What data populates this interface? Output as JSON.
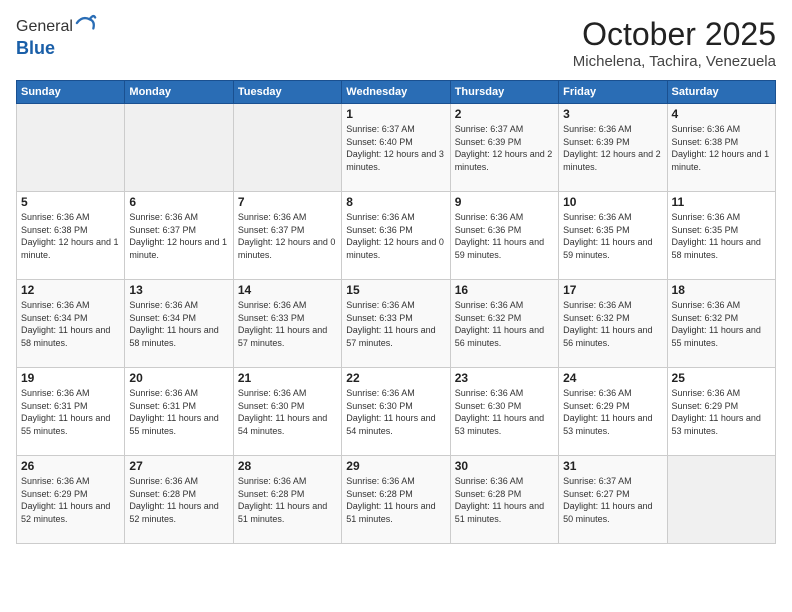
{
  "header": {
    "logo_line1": "General",
    "logo_line2": "Blue",
    "month": "October 2025",
    "location": "Michelena, Tachira, Venezuela"
  },
  "weekdays": [
    "Sunday",
    "Monday",
    "Tuesday",
    "Wednesday",
    "Thursday",
    "Friday",
    "Saturday"
  ],
  "weeks": [
    [
      {
        "day": "",
        "info": ""
      },
      {
        "day": "",
        "info": ""
      },
      {
        "day": "",
        "info": ""
      },
      {
        "day": "1",
        "info": "Sunrise: 6:37 AM\nSunset: 6:40 PM\nDaylight: 12 hours and 3 minutes."
      },
      {
        "day": "2",
        "info": "Sunrise: 6:37 AM\nSunset: 6:39 PM\nDaylight: 12 hours and 2 minutes."
      },
      {
        "day": "3",
        "info": "Sunrise: 6:36 AM\nSunset: 6:39 PM\nDaylight: 12 hours and 2 minutes."
      },
      {
        "day": "4",
        "info": "Sunrise: 6:36 AM\nSunset: 6:38 PM\nDaylight: 12 hours and 1 minute."
      }
    ],
    [
      {
        "day": "5",
        "info": "Sunrise: 6:36 AM\nSunset: 6:38 PM\nDaylight: 12 hours and 1 minute."
      },
      {
        "day": "6",
        "info": "Sunrise: 6:36 AM\nSunset: 6:37 PM\nDaylight: 12 hours and 1 minute."
      },
      {
        "day": "7",
        "info": "Sunrise: 6:36 AM\nSunset: 6:37 PM\nDaylight: 12 hours and 0 minutes."
      },
      {
        "day": "8",
        "info": "Sunrise: 6:36 AM\nSunset: 6:36 PM\nDaylight: 12 hours and 0 minutes."
      },
      {
        "day": "9",
        "info": "Sunrise: 6:36 AM\nSunset: 6:36 PM\nDaylight: 11 hours and 59 minutes."
      },
      {
        "day": "10",
        "info": "Sunrise: 6:36 AM\nSunset: 6:35 PM\nDaylight: 11 hours and 59 minutes."
      },
      {
        "day": "11",
        "info": "Sunrise: 6:36 AM\nSunset: 6:35 PM\nDaylight: 11 hours and 58 minutes."
      }
    ],
    [
      {
        "day": "12",
        "info": "Sunrise: 6:36 AM\nSunset: 6:34 PM\nDaylight: 11 hours and 58 minutes."
      },
      {
        "day": "13",
        "info": "Sunrise: 6:36 AM\nSunset: 6:34 PM\nDaylight: 11 hours and 58 minutes."
      },
      {
        "day": "14",
        "info": "Sunrise: 6:36 AM\nSunset: 6:33 PM\nDaylight: 11 hours and 57 minutes."
      },
      {
        "day": "15",
        "info": "Sunrise: 6:36 AM\nSunset: 6:33 PM\nDaylight: 11 hours and 57 minutes."
      },
      {
        "day": "16",
        "info": "Sunrise: 6:36 AM\nSunset: 6:32 PM\nDaylight: 11 hours and 56 minutes."
      },
      {
        "day": "17",
        "info": "Sunrise: 6:36 AM\nSunset: 6:32 PM\nDaylight: 11 hours and 56 minutes."
      },
      {
        "day": "18",
        "info": "Sunrise: 6:36 AM\nSunset: 6:32 PM\nDaylight: 11 hours and 55 minutes."
      }
    ],
    [
      {
        "day": "19",
        "info": "Sunrise: 6:36 AM\nSunset: 6:31 PM\nDaylight: 11 hours and 55 minutes."
      },
      {
        "day": "20",
        "info": "Sunrise: 6:36 AM\nSunset: 6:31 PM\nDaylight: 11 hours and 55 minutes."
      },
      {
        "day": "21",
        "info": "Sunrise: 6:36 AM\nSunset: 6:30 PM\nDaylight: 11 hours and 54 minutes."
      },
      {
        "day": "22",
        "info": "Sunrise: 6:36 AM\nSunset: 6:30 PM\nDaylight: 11 hours and 54 minutes."
      },
      {
        "day": "23",
        "info": "Sunrise: 6:36 AM\nSunset: 6:30 PM\nDaylight: 11 hours and 53 minutes."
      },
      {
        "day": "24",
        "info": "Sunrise: 6:36 AM\nSunset: 6:29 PM\nDaylight: 11 hours and 53 minutes."
      },
      {
        "day": "25",
        "info": "Sunrise: 6:36 AM\nSunset: 6:29 PM\nDaylight: 11 hours and 53 minutes."
      }
    ],
    [
      {
        "day": "26",
        "info": "Sunrise: 6:36 AM\nSunset: 6:29 PM\nDaylight: 11 hours and 52 minutes."
      },
      {
        "day": "27",
        "info": "Sunrise: 6:36 AM\nSunset: 6:28 PM\nDaylight: 11 hours and 52 minutes."
      },
      {
        "day": "28",
        "info": "Sunrise: 6:36 AM\nSunset: 6:28 PM\nDaylight: 11 hours and 51 minutes."
      },
      {
        "day": "29",
        "info": "Sunrise: 6:36 AM\nSunset: 6:28 PM\nDaylight: 11 hours and 51 minutes."
      },
      {
        "day": "30",
        "info": "Sunrise: 6:36 AM\nSunset: 6:28 PM\nDaylight: 11 hours and 51 minutes."
      },
      {
        "day": "31",
        "info": "Sunrise: 6:37 AM\nSunset: 6:27 PM\nDaylight: 11 hours and 50 minutes."
      },
      {
        "day": "",
        "info": ""
      }
    ]
  ]
}
